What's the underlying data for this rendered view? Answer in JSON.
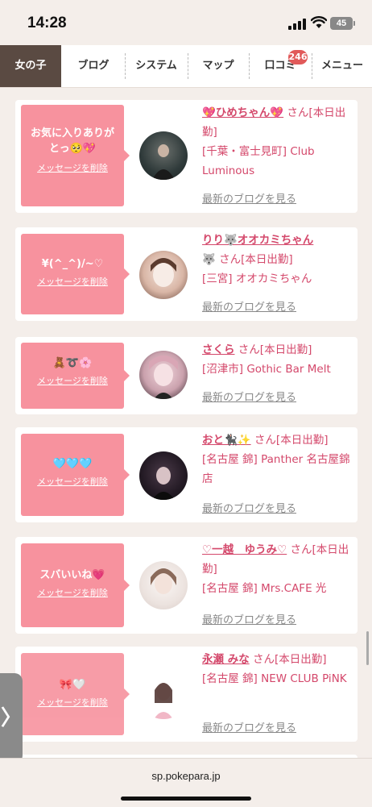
{
  "status": {
    "time": "14:28",
    "battery": "45"
  },
  "nav": {
    "tabs": [
      "女の子",
      "ブログ",
      "システム",
      "マップ",
      "口コミ",
      "メニュー"
    ],
    "badge": "246"
  },
  "cards": [
    {
      "message": "お気に入りありがとっ🥺💖",
      "delete": "メッセージを削除",
      "name": "💖ひめちゃん💖",
      "san": "さん[本日出勤]",
      "shop": "[千葉・富士見町] Club Luminous",
      "blog": "最新のブログを見る"
    },
    {
      "message": "¥(^_^)/~♡",
      "delete": "メッセージを削除",
      "name": "りり🐺オオカミちゃん",
      "name2": "🐺",
      "san": "さん[本日出勤]",
      "shop": "[三宮] オオカミちゃん",
      "blog": "最新のブログを見る"
    },
    {
      "message": "🧸➰🌸",
      "delete": "メッセージを削除",
      "name": "さくら",
      "san": "さん[本日出勤]",
      "shop": "[沼津市] Gothic Bar Melt",
      "blog": "最新のブログを見る"
    },
    {
      "message": "🩵🩵🩵",
      "delete": "メッセージを削除",
      "name": "おと🐈‍⬛✨",
      "san": "さん[本日出勤]",
      "shop": "[名古屋 錦] Panther 名古屋錦店",
      "blog": "最新のブログを見る"
    },
    {
      "message": "スバいいね💗",
      "delete": "メッセージを削除",
      "name": "♡一越　ゆうみ♡",
      "san": "さん[本日出勤]",
      "shop": "[名古屋 錦] Mrs.CAFE 光",
      "blog": "最新のブログを見る"
    },
    {
      "message": "🎀🤍",
      "delete": "メッセージを削除",
      "name": "永瀬 みな",
      "san": "さん[本日出勤]",
      "shop": "[名古屋 錦] NEW CLUB PiNK",
      "blog": "最新のブログを見る"
    }
  ],
  "side_tab": "〉",
  "url": "sp.pokepara.jp"
}
